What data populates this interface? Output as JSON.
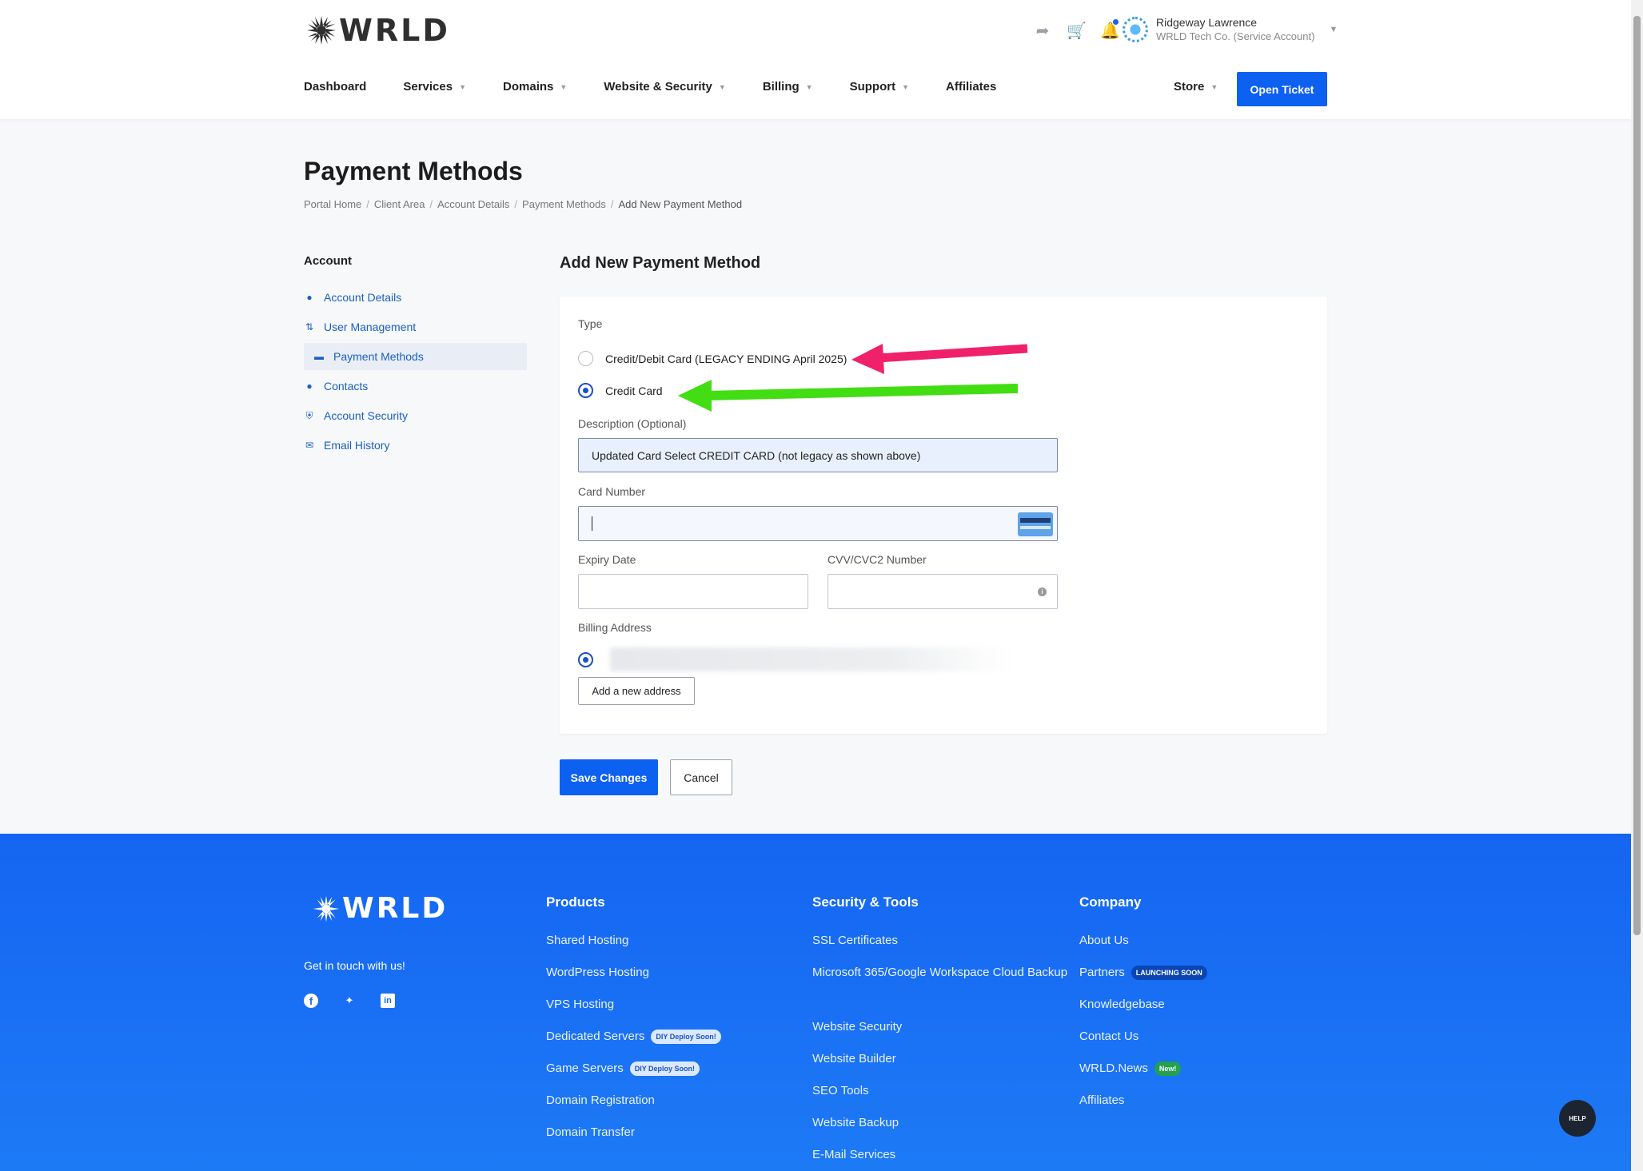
{
  "brand": {
    "name": "WRLD"
  },
  "header": {
    "user_name": "Ridgeway Lawrence",
    "user_org": "WRLD Tech Co. (Service Account)",
    "nav": [
      "Dashboard",
      "Services",
      "Domains",
      "Website & Security",
      "Billing",
      "Support",
      "Affiliates"
    ],
    "store": "Store",
    "open_ticket": "Open Ticket"
  },
  "page": {
    "title": "Payment Methods",
    "breadcrumb": [
      "Portal Home",
      "Client Area",
      "Account Details",
      "Payment Methods",
      "Add New Payment Method"
    ]
  },
  "sidebar": {
    "heading": "Account",
    "items": [
      {
        "label": "Account Details",
        "icon": "user-icon"
      },
      {
        "label": "User Management",
        "icon": "users-sort-icon"
      },
      {
        "label": "Payment Methods",
        "icon": "card-list-icon"
      },
      {
        "label": "Contacts",
        "icon": "user-icon"
      },
      {
        "label": "Account Security",
        "icon": "shield-icon"
      },
      {
        "label": "Email History",
        "icon": "mail-icon"
      }
    ]
  },
  "form": {
    "title": "Add New Payment Method",
    "type_label": "Type",
    "type_options": [
      "Credit/Debit Card (LEGACY ENDING April 2025)",
      "Credit Card"
    ],
    "selected_type": "Credit Card",
    "description_label": "Description (Optional)",
    "description_value": "Updated Card Select CREDIT CARD (not legacy as shown above)",
    "card_number_label": "Card Number",
    "card_number_value": "",
    "expiry_label": "Expiry Date",
    "cvv_label": "CVV/CVC2 Number",
    "billing_label": "Billing Address",
    "add_address": "Add a new address",
    "save": "Save Changes",
    "cancel": "Cancel"
  },
  "annotations": {
    "arrow_legacy_color": "#f0206a",
    "arrow_credit_color": "#42dd12"
  },
  "footer": {
    "touch": "Get in touch with us!",
    "products": {
      "heading": "Products",
      "items": [
        "Shared Hosting",
        "WordPress Hosting",
        "VPS Hosting",
        "Dedicated Servers",
        "Game Servers",
        "Domain Registration",
        "Domain Transfer"
      ],
      "badge": "DIY Deploy Soon!"
    },
    "security": {
      "heading": "Security & Tools",
      "items": [
        "SSL Certificates",
        "Microsoft 365/Google Workspace Cloud Backup",
        "Website Security",
        "Website Builder",
        "SEO Tools",
        "Website Backup",
        "E-Mail Services"
      ]
    },
    "company": {
      "heading": "Company",
      "items": [
        "About Us",
        "Partners",
        "Knowledgebase",
        "Contact Us",
        "WRLD.News",
        "Affiliates"
      ],
      "partners_badge": "LAUNCHING SOON",
      "news_badge": "New!"
    },
    "help": "HELP"
  },
  "colors": {
    "primary": "#0d61f0",
    "link": "#1b5fc7",
    "footer": "#1565f2"
  }
}
